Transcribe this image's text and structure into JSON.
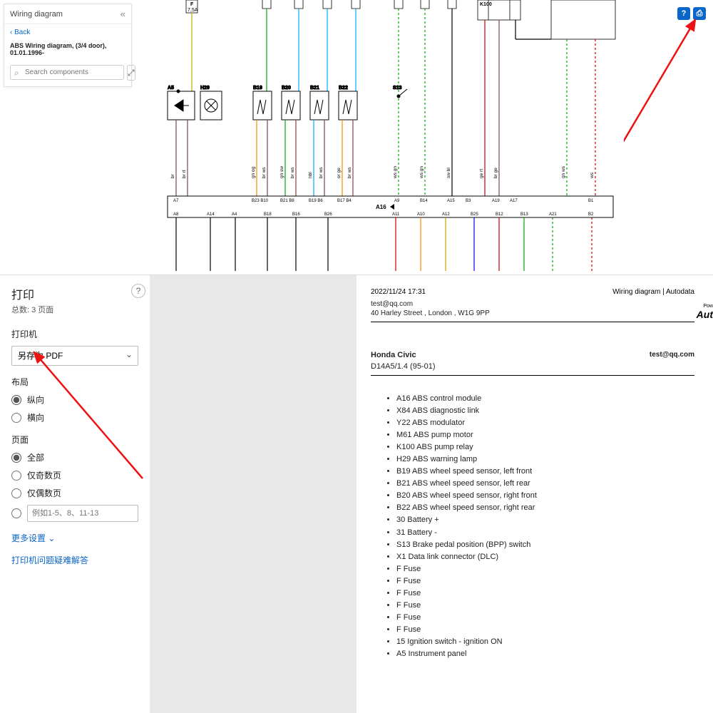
{
  "panel": {
    "header": "Wiring diagram",
    "back": "Back",
    "title": "ABS Wiring diagram, (3/4 door), 01.01.1996-",
    "search_placeholder": "Search components"
  },
  "top_icons": {
    "help": "?",
    "print": "⎙"
  },
  "diagram": {
    "top_labels": {
      "F": "F",
      "F_amp": "7,5A",
      "K100": "K100"
    },
    "comp_labels": [
      "A5",
      "H29",
      "B19",
      "B20",
      "B21",
      "B22",
      "S13"
    ],
    "wire_labels_upper": [
      "br",
      "br rt",
      "gn og",
      "br ws",
      "gn sw",
      "br ws",
      "hbl",
      "br ws",
      "or ge",
      "br ws",
      "ws gn",
      "ws gn",
      "sw bl",
      "ge rt",
      "br ge",
      "gn ws",
      "ws"
    ],
    "pin_row_top": [
      "A7",
      "",
      "B23 B10",
      "B21 B8",
      "B19 B6",
      "B17 B4",
      "",
      "A9",
      "B14",
      "A15",
      "B3",
      "A19",
      "A17",
      "",
      "B1"
    ],
    "module_label": "A16",
    "pin_row_bottom": [
      "A8",
      "A14",
      "A4",
      "B18",
      "B16",
      "B26",
      "",
      "A11",
      "A10",
      "A12",
      "B25",
      "B12",
      "B13",
      "A21",
      "B2"
    ]
  },
  "print": {
    "heading": "打印",
    "total_pages": "总数: 3 页面",
    "printer_label": "打印机",
    "printer_value": "另存为 PDF",
    "layout_label": "布局",
    "layout_portrait": "纵向",
    "layout_landscape": "横向",
    "pages_label": "页面",
    "pages_all": "全部",
    "pages_odd": "仅奇数页",
    "pages_even": "仅偶数页",
    "pages_custom_placeholder": "例如1-5、8、11-13",
    "more_settings": "更多设置",
    "troubleshoot": "打印机问题疑难解答"
  },
  "preview": {
    "timestamp": "2022/11/24 17:31",
    "doc_title": "Wiring diagram | Autodata",
    "email": "test@qq.com",
    "address": "40 Harley Street , London , W1G 9PP",
    "logo_small": "Pow",
    "logo_big": "Aut",
    "vehicle": "Honda Civic",
    "variant": "D14A5/1.4 (95-01)",
    "right_email": "test@qq.com",
    "components": [
      "A16 ABS control module",
      "X84 ABS diagnostic link",
      "Y22 ABS modulator",
      "M61 ABS pump motor",
      "K100 ABS pump relay",
      "H29 ABS warning lamp",
      "B19 ABS wheel speed sensor, left front",
      "B21 ABS wheel speed sensor, left rear",
      "B20 ABS wheel speed sensor, right front",
      "B22 ABS wheel speed sensor, right rear",
      "30 Battery +",
      "31 Battery -",
      "S13 Brake pedal position (BPP) switch",
      "X1 Data link connector (DLC)",
      "F Fuse",
      "F Fuse",
      "F Fuse",
      "F Fuse",
      "F Fuse",
      "F Fuse",
      "15 Ignition switch - ignition ON",
      "A5 Instrument panel"
    ]
  }
}
